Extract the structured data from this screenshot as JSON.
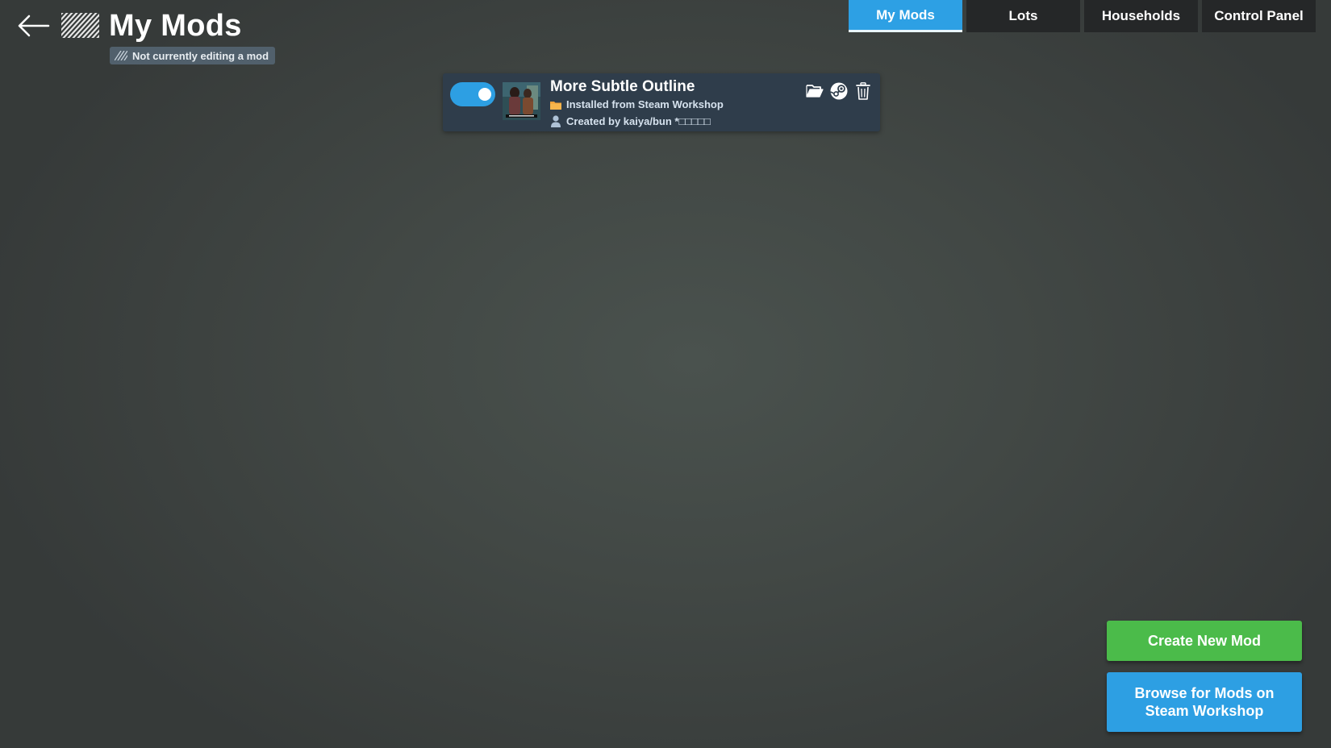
{
  "header": {
    "title": "My Mods",
    "back_icon": "arrow-left-icon",
    "mod_icon": "hatched-square-icon",
    "edit_status": "Not currently editing a mod"
  },
  "tabs": [
    {
      "label": "My Mods",
      "active": true
    },
    {
      "label": "Lots",
      "active": false
    },
    {
      "label": "Households",
      "active": false
    },
    {
      "label": "Control Panel",
      "active": false
    }
  ],
  "mods": [
    {
      "name": "More Subtle Outline",
      "enabled": true,
      "source": "Installed from Steam Workshop",
      "author": "Created by kaiya/bun *□□□□□",
      "actions": [
        "folder-open-icon",
        "steam-icon",
        "trash-icon"
      ]
    }
  ],
  "buttons": {
    "create": "Create New Mod",
    "browse": "Browse for Mods on Steam Workshop"
  },
  "colors": {
    "accent_blue": "#2da0e4",
    "create_green": "#4bbb4a",
    "card_bg": "#2f3d4b",
    "tab_bg": "#252728"
  }
}
